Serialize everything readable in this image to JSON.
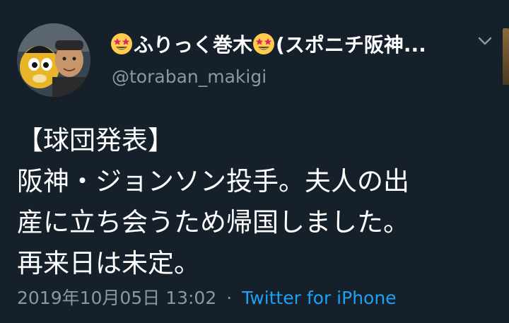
{
  "user": {
    "display_name": "ふりっく巻木",
    "display_name_suffix": "(スポニチ阪神...",
    "handle": "@toraban_makigi",
    "avatar": "profile-photo",
    "name_emoji": "star-struck-emoji"
  },
  "tweet": {
    "lines": [
      "【球団発表】",
      "阪神・ジョンソン投手。夫人の出",
      "産に立ち会うため帰国しました。",
      "再来日は未定。"
    ],
    "timestamp": "2019年10月05日 13:02",
    "separator": "·",
    "source": "Twitter for iPhone"
  },
  "icons": {
    "menu": "chevron-down-icon"
  },
  "colors": {
    "background": "#15202b",
    "text": "#ffffff",
    "muted": "#8899a6",
    "link": "#1da1f2"
  }
}
